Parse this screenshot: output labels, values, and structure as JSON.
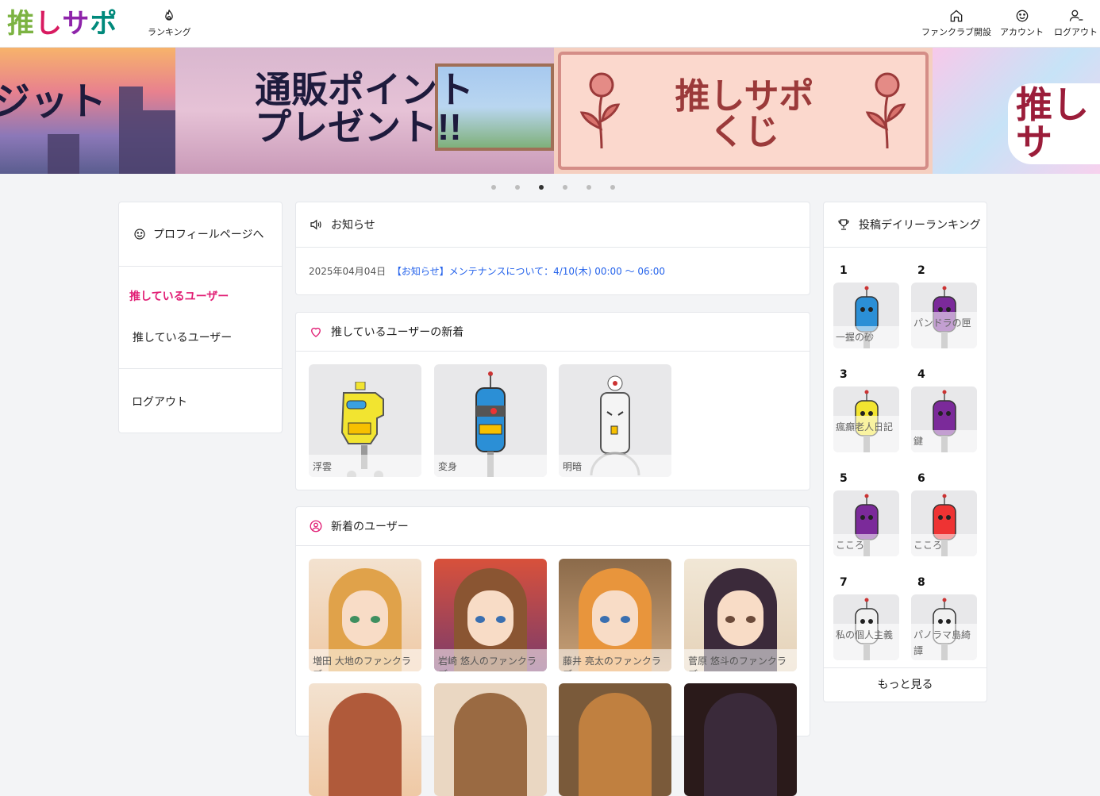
{
  "header": {
    "logo": [
      "推",
      "し",
      "サ",
      "ポ"
    ],
    "ranking_label": "ランキング",
    "fanclub_label": "ファンクラブ開設",
    "account_label": "アカウント",
    "logout_label": "ログアウト"
  },
  "banner": {
    "slides": [
      "ジット",
      "通販ポイント\nプレゼント!!",
      "推しサポ\nくじ",
      "推しサ"
    ],
    "active_dot": 3,
    "dot_count": 6
  },
  "sidebar": {
    "profile_label": "プロフィールページへ",
    "section_title": "推しているユーザー",
    "item_label": "推しているユーザー",
    "logout_label": "ログアウト"
  },
  "notice": {
    "title": "お知らせ",
    "date": "2025年04月04日",
    "link_text": "【お知らせ】メンテナンスについて：4/10(木) 00:00 〜 06:00"
  },
  "following_new": {
    "title": "推しているユーザーの新着",
    "items": [
      "浮雲",
      "変身",
      "明暗"
    ]
  },
  "new_users": {
    "title": "新着のユーザー",
    "items": [
      "増田 大地のファンクラブ",
      "岩崎 悠人のファンクラブ",
      "藤井 亮太のファンクラブ",
      "菅原 悠斗のファンクラブ"
    ]
  },
  "ranking": {
    "title": "投稿デイリーランキング",
    "items": [
      {
        "rank": "1",
        "name": "一握の砂"
      },
      {
        "rank": "2",
        "name": "パンドラの匣"
      },
      {
        "rank": "3",
        "name": "瘋癲老人日記"
      },
      {
        "rank": "4",
        "name": "鍵"
      },
      {
        "rank": "5",
        "name": "こころ"
      },
      {
        "rank": "6",
        "name": "こころ"
      },
      {
        "rank": "7",
        "name": "私の個人主義"
      },
      {
        "rank": "8",
        "name": "パノラマ島綺譚"
      }
    ],
    "more_label": "もっと見る"
  },
  "colors": {
    "accent_pink": "#e11d74",
    "link_blue": "#2563eb",
    "border": "#e5e7eb"
  }
}
